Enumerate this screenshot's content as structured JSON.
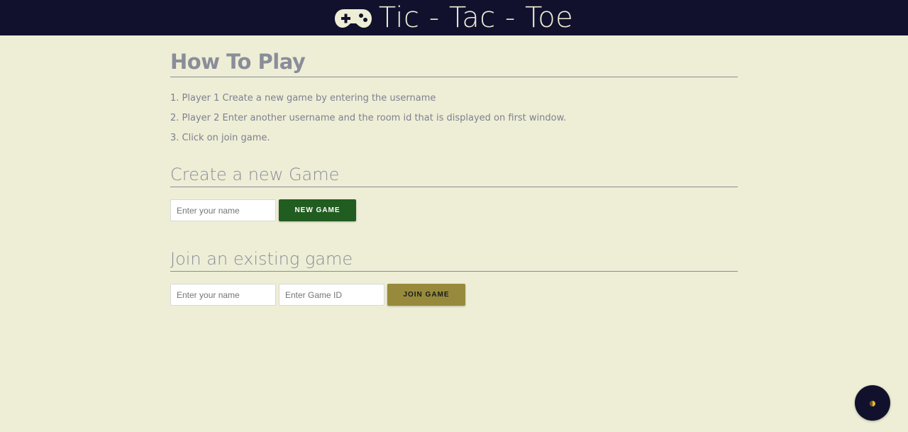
{
  "header": {
    "title": "Tic - Tac - Toe",
    "icon": "gamepad-icon"
  },
  "how_to_play": {
    "heading": "How To Play",
    "steps": [
      "1. Player 1 Create a new game by entering the username",
      "2. Player 2 Enter another username and the room id that is displayed on first window.",
      "3. Click on join game."
    ]
  },
  "create_game": {
    "heading": "Create a new Game",
    "name_placeholder": "Enter your name",
    "name_value": "",
    "button_label": "NEW GAME"
  },
  "join_game": {
    "heading": "Join an existing game",
    "name_placeholder": "Enter your name",
    "name_value": "",
    "game_id_placeholder": "Enter Game ID",
    "game_id_value": "",
    "button_label": "JOIN GAME"
  },
  "theme_toggle": {
    "icon": "theme-toggle-icon"
  },
  "colors": {
    "header_bg": "#11112e",
    "page_bg": "#eeeed6",
    "new_game_button": "#215d20",
    "join_game_button": "#978a3c",
    "heading_text": "#8a8d99"
  }
}
